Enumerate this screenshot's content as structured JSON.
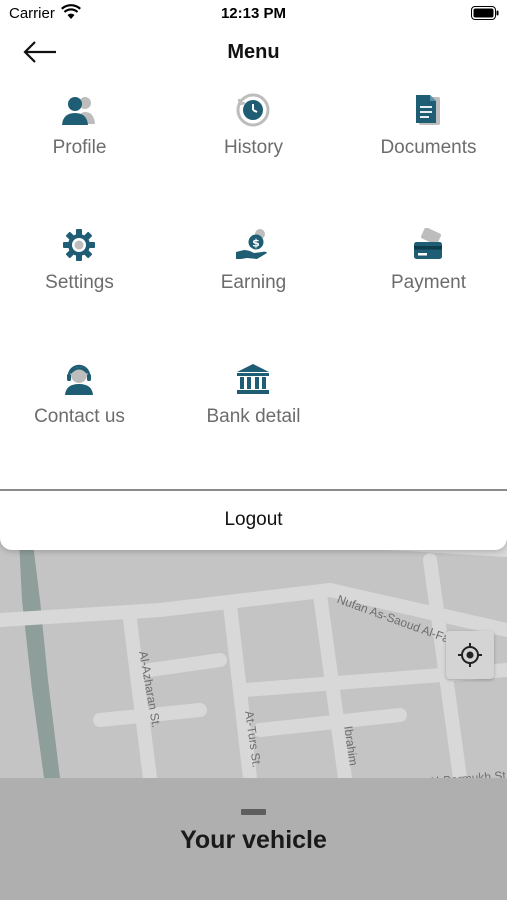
{
  "status_bar": {
    "carrier": "Carrier",
    "time": "12:13 PM",
    "wifi_icon": "wifi-icon",
    "battery_icon": "battery-icon"
  },
  "header": {
    "back_icon": "arrow-left-icon",
    "title": "Menu"
  },
  "menu": {
    "accent_color": "#1f5d74",
    "label_color": "#6c6c6c",
    "items": [
      {
        "label": "Profile",
        "icon": "profile-icon"
      },
      {
        "label": "History",
        "icon": "history-icon"
      },
      {
        "label": "Documents",
        "icon": "documents-icon"
      },
      {
        "label": "Settings",
        "icon": "gear-icon"
      },
      {
        "label": "Earning",
        "icon": "earning-icon"
      },
      {
        "label": "Payment",
        "icon": "card-icon"
      },
      {
        "label": "Contact us",
        "icon": "support-agent-icon"
      },
      {
        "label": "Bank detail",
        "icon": "bank-icon"
      }
    ],
    "logout_label": "Logout"
  },
  "map": {
    "streets": [
      "Nufan As-Saoud Al-Fahd",
      "Al-Azharan St.",
      "At-Turs St.",
      "Ibrahim",
      "Al-Barmukh St."
    ],
    "locate_icon": "crosshair-icon"
  },
  "bottom_sheet": {
    "title": "Your vehicle"
  }
}
